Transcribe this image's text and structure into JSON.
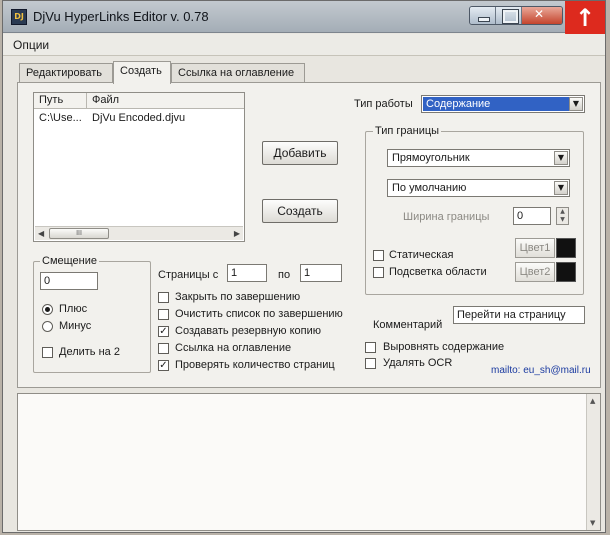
{
  "window": {
    "title": "DjVu HyperLinks Editor v. 0.78",
    "app_icon": "djvu-app-icon",
    "icon_glyph": "DJ"
  },
  "caption_buttons": [
    "minimize-icon",
    "maximize-icon",
    "close-icon"
  ],
  "menu": {
    "options": "Опции"
  },
  "tabs": [
    {
      "label": "Редактировать",
      "active": false
    },
    {
      "label": "Создать",
      "active": true
    },
    {
      "label": "Ссылка на оглавление",
      "active": false
    }
  ],
  "file_list": {
    "columns": [
      "Путь",
      "Файл"
    ],
    "rows": [
      {
        "path": "C:\\Use...",
        "file": "DjVu Encoded.djvu"
      }
    ],
    "scroll_thumb_glyph": "III"
  },
  "buttons": {
    "add": "Добавить",
    "create": "Создать"
  },
  "work_type": {
    "label": "Тип работы",
    "value": "Содержание"
  },
  "border_type": {
    "title": "Тип границы",
    "shape": "Прямоугольник",
    "style": "По умолчанию",
    "width_label": "Ширина границы",
    "width_value": "0",
    "static_label": "Статическая",
    "highlight_label": "Подсветка области",
    "color1_label": "Цвет1",
    "color2_label": "Цвет2",
    "color1": "#111111",
    "color2": "#111111"
  },
  "offset": {
    "title": "Смещение",
    "value": "0",
    "plus": "Плюс",
    "minus": "Минус",
    "divide": "Делить на 2",
    "selected": "plus"
  },
  "pages": {
    "from_label": "Страницы с",
    "from_value": "1",
    "to_label": "по",
    "to_value": "1"
  },
  "options": [
    {
      "label": "Закрыть по завершению",
      "checked": false
    },
    {
      "label": "Очистить список по завершению",
      "checked": false
    },
    {
      "label": "Создавать резервную копию",
      "checked": true
    },
    {
      "label": "Ссылка на оглавление",
      "checked": false
    },
    {
      "label": "Проверять количество страниц",
      "checked": true
    }
  ],
  "comment": {
    "label": "Комментарий",
    "value": "Перейти на страницу"
  },
  "right_options": [
    {
      "label": "Выровнять содержание",
      "checked": false
    },
    {
      "label": "Удалять OCR",
      "checked": false
    }
  ],
  "mailto": "mailto: eu_sh@mail.ru",
  "upload_glyph": "🡑"
}
